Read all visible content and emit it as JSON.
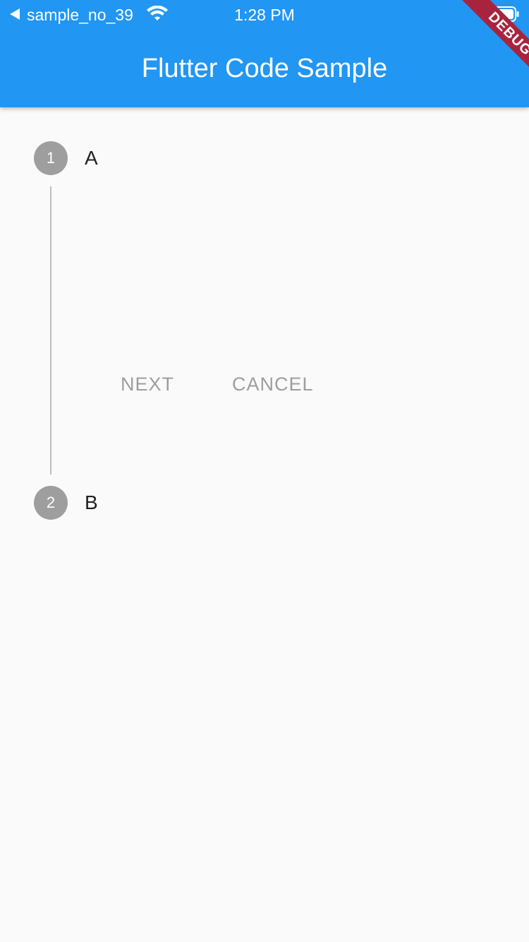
{
  "status_bar": {
    "carrier": "sample_no_39",
    "time": "1:28 PM",
    "icons": [
      "back-arrow-icon",
      "wifi-icon",
      "battery-icon"
    ]
  },
  "app_bar": {
    "title": "Flutter Code Sample"
  },
  "debug_banner": {
    "label": "DEBUG",
    "color": "#a8243e"
  },
  "stepper": {
    "steps": [
      {
        "number": "1",
        "title": "A"
      },
      {
        "number": "2",
        "title": "B"
      }
    ],
    "controls": {
      "next_label": "NEXT",
      "cancel_label": "CANCEL"
    }
  },
  "colors": {
    "app_bar": "#2196f3",
    "background": "#fafafa",
    "step_circle": "#9e9e9e",
    "connector": "#bdbdbd",
    "button_text": "#9e9e9e"
  }
}
